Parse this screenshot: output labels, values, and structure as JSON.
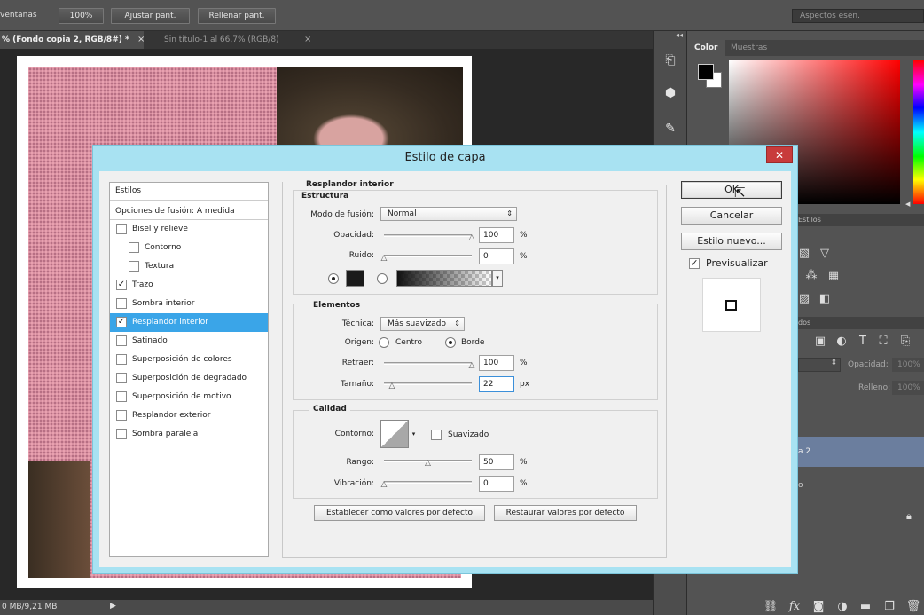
{
  "option_bar": {
    "windows_label": "ventanas",
    "zoom_button": "100%",
    "fit_button": "Ajustar pant.",
    "fill_button": "Rellenar pant.",
    "workspace_field": "Aspectos esen."
  },
  "doc_tabs": [
    {
      "label": "% (Fondo copia 2, RGB/8#) *",
      "close": "×"
    },
    {
      "label": "Sin título-1 al 66,7% (RGB/8)",
      "close": "×"
    }
  ],
  "status_bar": {
    "doc_size": "0 MB/9,21 MB",
    "arrow": "▶"
  },
  "right_panels": {
    "collapse_arrows": "◂◂",
    "color_tab": "Color",
    "swatches_tab": "Muestras",
    "styles_tab": "Estilos",
    "layers_tab": "dos",
    "opacity_label": "Opacidad:",
    "opacity_value": "100%",
    "fill_label": "Relleno:",
    "fill_value": "100%",
    "layer_name": "a 2",
    "layer_name2": "o",
    "colors": {
      "foreground": "#000000",
      "background": "#ffffff"
    }
  },
  "dialog": {
    "title": "Estilo de capa",
    "close_icon": "✕",
    "styles_header": "Estilos",
    "blending_options": "Opciones de fusión: A medida",
    "style_items": [
      {
        "label": "Bisel y relieve",
        "checked": false,
        "indent": false
      },
      {
        "label": "Contorno",
        "checked": false,
        "indent": true
      },
      {
        "label": "Textura",
        "checked": false,
        "indent": true
      },
      {
        "label": "Trazo",
        "checked": true,
        "indent": false
      },
      {
        "label": "Sombra interior",
        "checked": false,
        "indent": false
      },
      {
        "label": "Resplandor interior",
        "checked": true,
        "indent": false,
        "selected": true
      },
      {
        "label": "Satinado",
        "checked": false,
        "indent": false
      },
      {
        "label": "Superposición de colores",
        "checked": false,
        "indent": false
      },
      {
        "label": "Superposición de degradado",
        "checked": false,
        "indent": false
      },
      {
        "label": "Superposición de motivo",
        "checked": false,
        "indent": false
      },
      {
        "label": "Resplandor exterior",
        "checked": false,
        "indent": false
      },
      {
        "label": "Sombra paralela",
        "checked": false,
        "indent": false
      }
    ],
    "section_title": "Resplandor interior",
    "structure": {
      "title": "Estructura",
      "blend_mode_label": "Modo de fusión:",
      "blend_mode_value": "Normal",
      "opacity_label": "Opacidad:",
      "opacity_value": "100",
      "opacity_fraction": 1.0,
      "noise_label": "Ruido:",
      "noise_value": "0",
      "noise_fraction": 0.0,
      "percent": "%",
      "glow_color": "#1a1a1a"
    },
    "elements": {
      "title": "Elementos",
      "technique_label": "Técnica:",
      "technique_value": "Más suavizado",
      "source_label": "Origen:",
      "source_center": "Centro",
      "source_edge": "Borde",
      "choke_label": "Retraer:",
      "choke_value": "100",
      "choke_fraction": 1.0,
      "size_label": "Tamaño:",
      "size_value": "22",
      "size_fraction": 0.09,
      "percent": "%",
      "px": "px"
    },
    "quality": {
      "title": "Calidad",
      "contour_label": "Contorno:",
      "antialias_label": "Suavizado",
      "range_label": "Rango:",
      "range_value": "50",
      "range_fraction": 0.5,
      "jitter_label": "Vibración:",
      "jitter_value": "0",
      "jitter_fraction": 0.0,
      "percent": "%"
    },
    "make_default": "Establecer como valores por defecto",
    "reset_default": "Restaurar valores por defecto",
    "ok": "OK",
    "cancel": "Cancelar",
    "new_style": "Estilo nuevo...",
    "preview_label": "Previsualizar",
    "preview_checked": true
  }
}
